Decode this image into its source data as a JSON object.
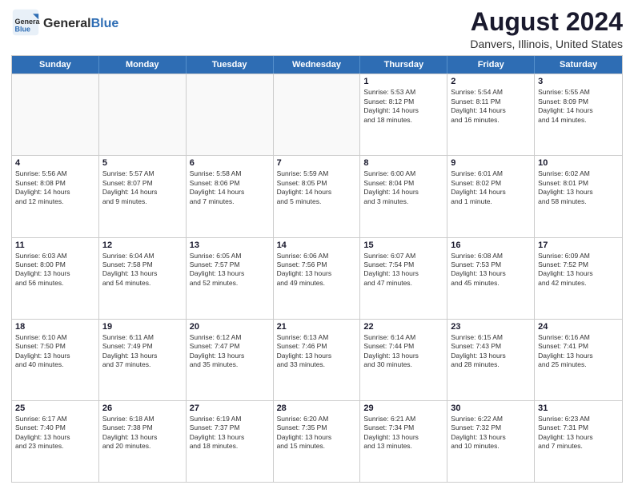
{
  "header": {
    "logo_general": "General",
    "logo_blue": "Blue",
    "month_year": "August 2024",
    "location": "Danvers, Illinois, United States"
  },
  "calendar": {
    "days_of_week": [
      "Sunday",
      "Monday",
      "Tuesday",
      "Wednesday",
      "Thursday",
      "Friday",
      "Saturday"
    ],
    "rows": [
      [
        {
          "day": "",
          "empty": true
        },
        {
          "day": "",
          "empty": true
        },
        {
          "day": "",
          "empty": true
        },
        {
          "day": "",
          "empty": true
        },
        {
          "day": "1",
          "text": "Sunrise: 5:53 AM\nSunset: 8:12 PM\nDaylight: 14 hours\nand 18 minutes."
        },
        {
          "day": "2",
          "text": "Sunrise: 5:54 AM\nSunset: 8:11 PM\nDaylight: 14 hours\nand 16 minutes."
        },
        {
          "day": "3",
          "text": "Sunrise: 5:55 AM\nSunset: 8:09 PM\nDaylight: 14 hours\nand 14 minutes."
        }
      ],
      [
        {
          "day": "4",
          "text": "Sunrise: 5:56 AM\nSunset: 8:08 PM\nDaylight: 14 hours\nand 12 minutes."
        },
        {
          "day": "5",
          "text": "Sunrise: 5:57 AM\nSunset: 8:07 PM\nDaylight: 14 hours\nand 9 minutes."
        },
        {
          "day": "6",
          "text": "Sunrise: 5:58 AM\nSunset: 8:06 PM\nDaylight: 14 hours\nand 7 minutes."
        },
        {
          "day": "7",
          "text": "Sunrise: 5:59 AM\nSunset: 8:05 PM\nDaylight: 14 hours\nand 5 minutes."
        },
        {
          "day": "8",
          "text": "Sunrise: 6:00 AM\nSunset: 8:04 PM\nDaylight: 14 hours\nand 3 minutes."
        },
        {
          "day": "9",
          "text": "Sunrise: 6:01 AM\nSunset: 8:02 PM\nDaylight: 14 hours\nand 1 minute."
        },
        {
          "day": "10",
          "text": "Sunrise: 6:02 AM\nSunset: 8:01 PM\nDaylight: 13 hours\nand 58 minutes."
        }
      ],
      [
        {
          "day": "11",
          "text": "Sunrise: 6:03 AM\nSunset: 8:00 PM\nDaylight: 13 hours\nand 56 minutes."
        },
        {
          "day": "12",
          "text": "Sunrise: 6:04 AM\nSunset: 7:58 PM\nDaylight: 13 hours\nand 54 minutes."
        },
        {
          "day": "13",
          "text": "Sunrise: 6:05 AM\nSunset: 7:57 PM\nDaylight: 13 hours\nand 52 minutes."
        },
        {
          "day": "14",
          "text": "Sunrise: 6:06 AM\nSunset: 7:56 PM\nDaylight: 13 hours\nand 49 minutes."
        },
        {
          "day": "15",
          "text": "Sunrise: 6:07 AM\nSunset: 7:54 PM\nDaylight: 13 hours\nand 47 minutes."
        },
        {
          "day": "16",
          "text": "Sunrise: 6:08 AM\nSunset: 7:53 PM\nDaylight: 13 hours\nand 45 minutes."
        },
        {
          "day": "17",
          "text": "Sunrise: 6:09 AM\nSunset: 7:52 PM\nDaylight: 13 hours\nand 42 minutes."
        }
      ],
      [
        {
          "day": "18",
          "text": "Sunrise: 6:10 AM\nSunset: 7:50 PM\nDaylight: 13 hours\nand 40 minutes."
        },
        {
          "day": "19",
          "text": "Sunrise: 6:11 AM\nSunset: 7:49 PM\nDaylight: 13 hours\nand 37 minutes."
        },
        {
          "day": "20",
          "text": "Sunrise: 6:12 AM\nSunset: 7:47 PM\nDaylight: 13 hours\nand 35 minutes."
        },
        {
          "day": "21",
          "text": "Sunrise: 6:13 AM\nSunset: 7:46 PM\nDaylight: 13 hours\nand 33 minutes."
        },
        {
          "day": "22",
          "text": "Sunrise: 6:14 AM\nSunset: 7:44 PM\nDaylight: 13 hours\nand 30 minutes."
        },
        {
          "day": "23",
          "text": "Sunrise: 6:15 AM\nSunset: 7:43 PM\nDaylight: 13 hours\nand 28 minutes."
        },
        {
          "day": "24",
          "text": "Sunrise: 6:16 AM\nSunset: 7:41 PM\nDaylight: 13 hours\nand 25 minutes."
        }
      ],
      [
        {
          "day": "25",
          "text": "Sunrise: 6:17 AM\nSunset: 7:40 PM\nDaylight: 13 hours\nand 23 minutes."
        },
        {
          "day": "26",
          "text": "Sunrise: 6:18 AM\nSunset: 7:38 PM\nDaylight: 13 hours\nand 20 minutes."
        },
        {
          "day": "27",
          "text": "Sunrise: 6:19 AM\nSunset: 7:37 PM\nDaylight: 13 hours\nand 18 minutes."
        },
        {
          "day": "28",
          "text": "Sunrise: 6:20 AM\nSunset: 7:35 PM\nDaylight: 13 hours\nand 15 minutes."
        },
        {
          "day": "29",
          "text": "Sunrise: 6:21 AM\nSunset: 7:34 PM\nDaylight: 13 hours\nand 13 minutes."
        },
        {
          "day": "30",
          "text": "Sunrise: 6:22 AM\nSunset: 7:32 PM\nDaylight: 13 hours\nand 10 minutes."
        },
        {
          "day": "31",
          "text": "Sunrise: 6:23 AM\nSunset: 7:31 PM\nDaylight: 13 hours\nand 7 minutes."
        }
      ]
    ]
  }
}
